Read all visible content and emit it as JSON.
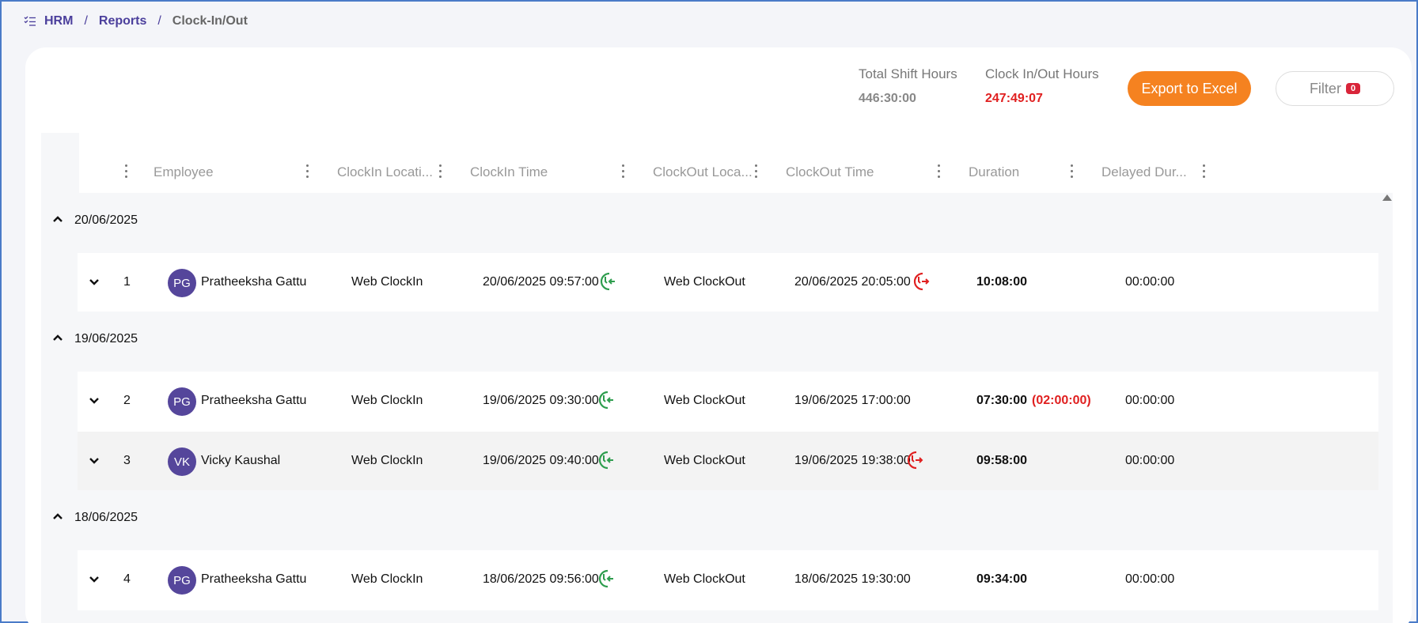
{
  "breadcrumb": {
    "items": [
      "HRM",
      "Reports",
      "Clock-In/Out"
    ]
  },
  "summary": {
    "shift_label": "Total Shift Hours",
    "shift_value": "446:30:00",
    "clock_label": "Clock In/Out Hours",
    "clock_value": "247:49:07"
  },
  "toolbar": {
    "export_label": "Export to Excel",
    "filter_label": "Filter",
    "filter_count": "0"
  },
  "columns": [
    "Employee",
    "ClockIn Locati...",
    "ClockIn Time",
    "ClockOut Loca...",
    "ClockOut Time",
    "Duration",
    "Delayed Dur..."
  ],
  "groups": [
    {
      "date": "20/06/2025"
    },
    {
      "date": "19/06/2025"
    },
    {
      "date": "18/06/2025"
    }
  ],
  "rows": [
    {
      "num": "1",
      "initials": "PG",
      "name": "Pratheeksha Gattu",
      "in_loc": "Web ClockIn",
      "in_time": "20/06/2025 09:57:00",
      "out_loc": "Web ClockOut",
      "out_time": "20/06/2025 20:05:00",
      "duration": "10:08:00",
      "delay_extra": "",
      "delayed": "00:00:00"
    },
    {
      "num": "2",
      "initials": "PG",
      "name": "Pratheeksha Gattu",
      "in_loc": "Web ClockIn",
      "in_time": "19/06/2025 09:30:00",
      "out_loc": "Web ClockOut",
      "out_time": "19/06/2025 17:00:00",
      "duration": "07:30:00",
      "delay_extra": "(02:00:00)",
      "delayed": "00:00:00"
    },
    {
      "num": "3",
      "initials": "VK",
      "name": "Vicky Kaushal",
      "in_loc": "Web ClockIn",
      "in_time": "19/06/2025 09:40:00",
      "out_loc": "Web ClockOut",
      "out_time": "19/06/2025 19:38:00",
      "duration": "09:58:00",
      "delay_extra": "",
      "delayed": "00:00:00"
    },
    {
      "num": "4",
      "initials": "PG",
      "name": "Pratheeksha Gattu",
      "in_loc": "Web ClockIn",
      "in_time": "18/06/2025 09:56:00",
      "out_loc": "Web ClockOut",
      "out_time": "18/06/2025 19:30:00",
      "duration": "09:34:00",
      "delay_extra": "",
      "delayed": "00:00:00"
    }
  ],
  "colors": {
    "accent": "#4b3f9c",
    "export": "#f58220",
    "badge": "#d9253a",
    "clockin": "#2e9d4e",
    "clockout": "#e02020"
  }
}
